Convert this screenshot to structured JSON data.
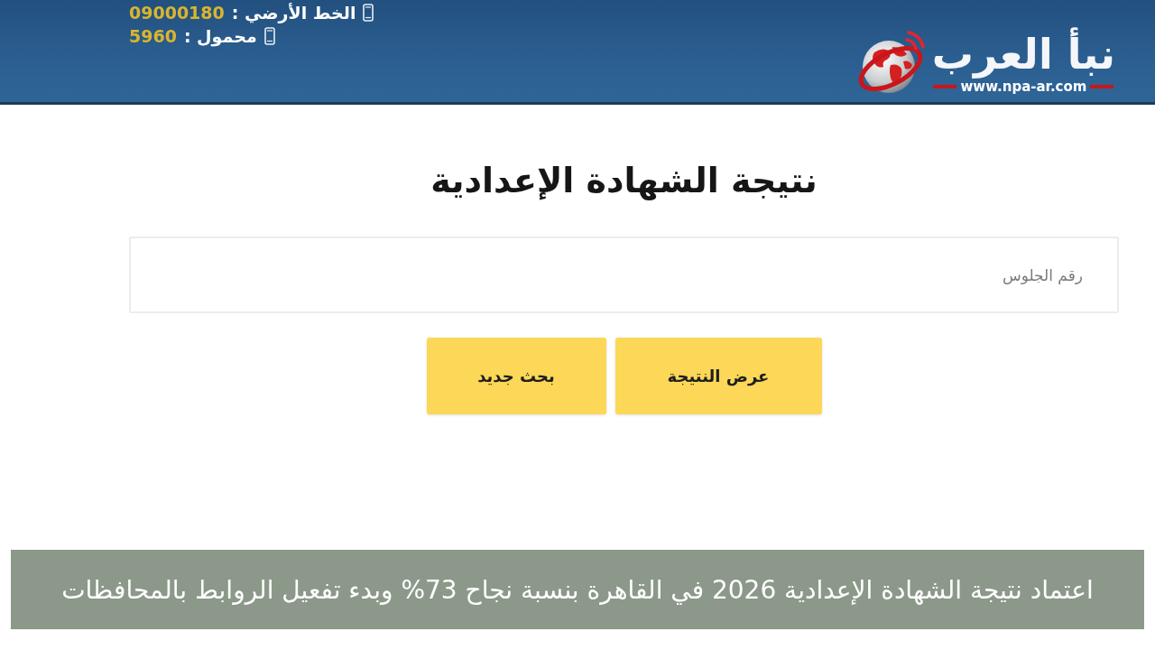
{
  "header": {
    "contacts": [
      {
        "label": "الخط الأرضي :",
        "value": "09000180"
      },
      {
        "label": "محمول :",
        "value": "5960"
      }
    ],
    "logo": {
      "name": "نبأ العرب",
      "url": "www.npa-ar.com"
    }
  },
  "form": {
    "title": "نتيجة الشهادة الإعدادية",
    "seat_field": {
      "placeholder": "رقم الجلوس"
    },
    "buttons": [
      {
        "label": "عرض النتيجة"
      },
      {
        "label": "بحث جديد"
      }
    ]
  },
  "caption": "اعتماد نتيجة الشهادة الإعدادية 2026 في القاهرة بنسبة نجاح 73% وبدء تفعيل الروابط بالمحافظات"
}
